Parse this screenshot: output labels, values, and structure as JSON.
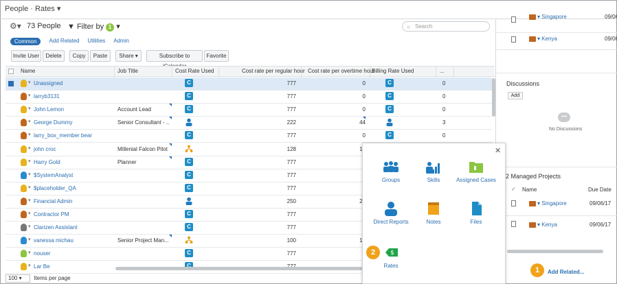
{
  "header": {
    "title": "People · Rates ▾"
  },
  "toolbar": {
    "count_label": "73 People",
    "filter_label": "Filter by",
    "filter_badge": "1",
    "search_placeholder": "Search"
  },
  "tabs": [
    "Common",
    "Add Related",
    "Utilities",
    "Admin"
  ],
  "buttons": {
    "invite_user": "Invite User",
    "delete": "Delete",
    "copy": "Copy",
    "paste": "Paste",
    "share": "Share ▾",
    "subscribe": "Subscribe to iCalendar",
    "favorite": "Favorite"
  },
  "grid": {
    "columns": [
      "Name",
      "Job Title",
      "Cost Rate Used",
      "Cost rate per regular hour",
      "Cost rate per overtime hour",
      "Billing Rate Used",
      "..."
    ],
    "rows": [
      {
        "name": "Unassigned",
        "job": "",
        "cost_icon": "C",
        "reg": "777",
        "ot": "0",
        "bill_icon": "C",
        "extra": "0"
      },
      {
        "name": "larryb3131",
        "job": "",
        "cost_icon": "C",
        "reg": "777",
        "ot": "0",
        "bill_icon": "C",
        "extra": "0"
      },
      {
        "name": "John Lemon",
        "job": "Account Lead",
        "cost_icon": "C",
        "reg": "777",
        "ot": "0",
        "bill_icon": "C",
        "extra": "0"
      },
      {
        "name": "George Dummy",
        "job": "Senior Consultant - ...",
        "cost_icon": "person",
        "reg": "222",
        "ot": "44",
        "bill_icon": "person",
        "extra": "3"
      },
      {
        "name": "larry_box_member bear",
        "job": "",
        "cost_icon": "C",
        "reg": "777",
        "ot": "0",
        "bill_icon": "C",
        "extra": "0"
      },
      {
        "name": "john croc",
        "job": "Millenial Falcon Pilot",
        "cost_icon": "org",
        "reg": "128",
        "ot": "12",
        "bill_icon": "",
        "extra": ""
      },
      {
        "name": "Harry Gold",
        "job": "Planner",
        "cost_icon": "C",
        "reg": "777",
        "ot": "",
        "bill_icon": "",
        "extra": ""
      },
      {
        "name": "$SystemAnalyst",
        "job": "",
        "cost_icon": "C",
        "reg": "777",
        "ot": "",
        "bill_icon": "",
        "extra": ""
      },
      {
        "name": "$placeholder_QA",
        "job": "",
        "cost_icon": "C",
        "reg": "777",
        "ot": "",
        "bill_icon": "",
        "extra": ""
      },
      {
        "name": "Financial Admin",
        "job": "",
        "cost_icon": "person",
        "reg": "250",
        "ot": "26",
        "bill_icon": "",
        "extra": ""
      },
      {
        "name": "Contractor PM",
        "job": "",
        "cost_icon": "C",
        "reg": "777",
        "ot": "",
        "bill_icon": "",
        "extra": ""
      },
      {
        "name": "Clarizen Assistant",
        "job": "",
        "cost_icon": "C",
        "reg": "777",
        "ot": "",
        "bill_icon": "",
        "extra": ""
      },
      {
        "name": "vanessa michau",
        "job": "Senior Project Man...",
        "cost_icon": "org",
        "reg": "100",
        "ot": "15",
        "bill_icon": "",
        "extra": ""
      },
      {
        "name": "nouser",
        "job": "",
        "cost_icon": "C",
        "reg": "777",
        "ot": "",
        "bill_icon": "",
        "extra": ""
      },
      {
        "name": "Lar Be",
        "job": "",
        "cost_icon": "C",
        "reg": "777",
        "ot": "",
        "bill_icon": "",
        "extra": ""
      }
    ]
  },
  "footer": {
    "page_size": "100",
    "label": "Items per page"
  },
  "popup": {
    "items": [
      "Groups",
      "Skills",
      "Assigned Cases",
      "Direct Reports",
      "Notes",
      "Files",
      "Rates"
    ],
    "rates_badge": "2"
  },
  "right_panel": {
    "top_projects": [
      {
        "name": "Singapore",
        "date": "09/06"
      },
      {
        "name": "Kenya",
        "date": "09/06"
      }
    ],
    "discussions_title": "Discussions",
    "add_label": "Add",
    "no_discussions": "No Discussions",
    "managed_title": "2 Managed Projects",
    "col_name": "Name",
    "col_due": "Due Date",
    "managed": [
      {
        "name": "Singapore",
        "date": "09/06/17"
      },
      {
        "name": "Kenya",
        "date": "09/06/17"
      }
    ],
    "add_related_label": "Add Related...",
    "add_related_badge": "1"
  },
  "colors": {
    "accent": "#2a6db0",
    "rate_icon": "#1f8dc7",
    "badge": "#f0a21a",
    "green": "#8cc540"
  }
}
